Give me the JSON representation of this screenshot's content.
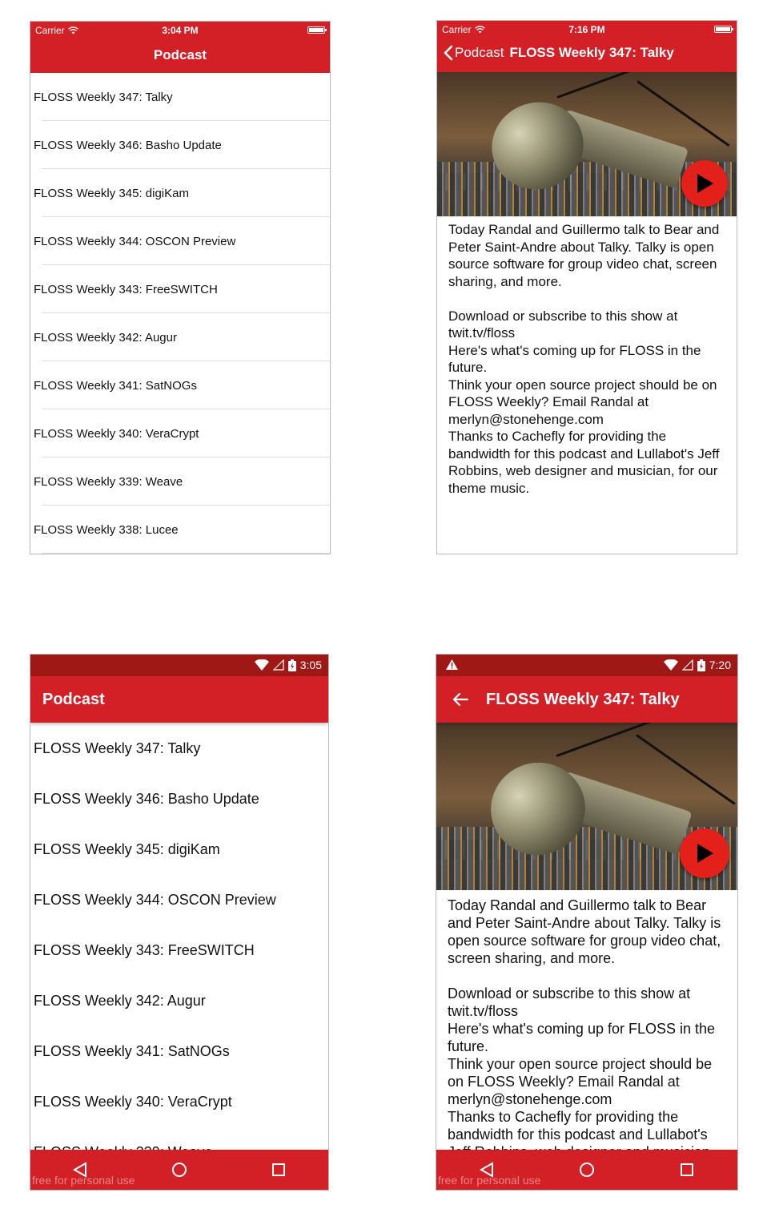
{
  "colors": {
    "primary": "#d32027",
    "status_dark": "#a01815",
    "play": "#e4201b"
  },
  "ios": {
    "carrier": "Carrier",
    "list_time": "3:04 PM",
    "detail_time": "7:16 PM",
    "list_title": "Podcast",
    "back_label": "Podcast",
    "detail_title": "FLOSS Weekly 347: Talky"
  },
  "android": {
    "list_time": "3:05",
    "detail_time": "7:20",
    "list_title": "Podcast",
    "detail_title": "FLOSS Weekly 347: Talky",
    "watermark": "free for personal use"
  },
  "episodes": [
    "FLOSS Weekly 347: Talky",
    "FLOSS Weekly 346: Basho Update",
    "FLOSS Weekly 345: digiKam",
    "FLOSS Weekly 344: OSCON Preview",
    "FLOSS Weekly 343: FreeSWITCH",
    "FLOSS Weekly 342: Augur",
    "FLOSS Weekly 341: SatNOGs",
    "FLOSS Weekly 340: VeraCrypt",
    "FLOSS Weekly 339: Weave",
    "FLOSS Weekly 338: Lucee"
  ],
  "description": {
    "intro": "Today Randal and Guillermo talk to Bear and Peter Saint-Andre about Talky. Talky is open source software for group video chat, screen sharing, and more.",
    "download": "Download or subscribe to this show at twit.tv/floss",
    "coming_up": "Here's what's coming up for FLOSS in the future.",
    "think": "Think your open source project should be on FLOSS Weekly? Email Randal at merlyn@stonehenge.com",
    "thanks": "Thanks to Cachefly for providing the bandwidth for this podcast and Lullabot's Jeff Robbins, web designer and musician, for our theme music."
  },
  "icons": {
    "wifi": "wifi-icon",
    "battery": "battery-icon",
    "back": "chevron-left-icon",
    "play": "play-icon",
    "signal": "cell-signal-icon",
    "warning": "warning-icon",
    "nav_back": "triangle-back-icon",
    "nav_home": "circle-home-icon",
    "nav_recents": "square-recents-icon"
  }
}
